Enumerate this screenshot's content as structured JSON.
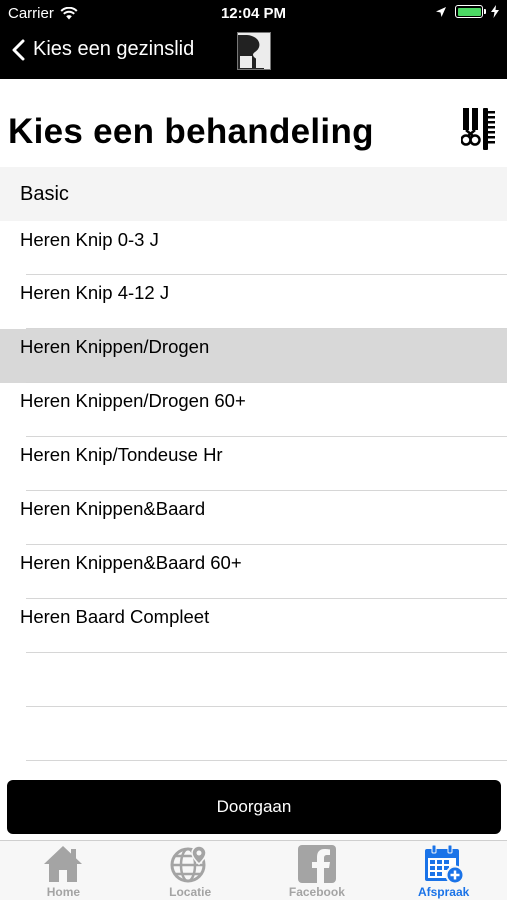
{
  "status_bar": {
    "carrier": "Carrier",
    "time": "12:04 PM",
    "battery_level": 1.0,
    "icons": [
      "wifi-icon",
      "location-arrow-icon",
      "battery-icon",
      "charging-icon"
    ]
  },
  "nav": {
    "back_label": "Kies een gezinslid",
    "logo_text": "R B"
  },
  "page": {
    "title": "Kies een behandeling"
  },
  "section": {
    "title": "Basic"
  },
  "items": [
    {
      "label": "Heren Knip  0-3  J",
      "selected": false
    },
    {
      "label": "Heren Knip  4-12 J",
      "selected": false
    },
    {
      "label": "Heren Knippen/Drogen",
      "selected": true
    },
    {
      "label": "Heren Knippen/Drogen 60+",
      "selected": false
    },
    {
      "label": "Heren Knip/Tondeuse Hr",
      "selected": false
    },
    {
      "label": "Heren Knippen&Baard",
      "selected": false
    },
    {
      "label": "Heren Knippen&Baard 60+",
      "selected": false
    },
    {
      "label": "Heren Baard Compleet",
      "selected": false
    }
  ],
  "continue_button": {
    "label": "Doorgaan"
  },
  "tabs": [
    {
      "label": "Home",
      "icon": "home-icon",
      "active": false
    },
    {
      "label": "Locatie",
      "icon": "globe-location-icon",
      "active": false
    },
    {
      "label": "Facebook",
      "icon": "facebook-icon",
      "active": false
    },
    {
      "label": "Afspraak",
      "icon": "calendar-add-icon",
      "active": true
    }
  ],
  "colors": {
    "bar_background": "#000000",
    "selected_row": "#d8d8d8",
    "active_tab": "#1a73e8",
    "inactive_tab": "#a4a4a4",
    "battery": "#4cd964"
  }
}
